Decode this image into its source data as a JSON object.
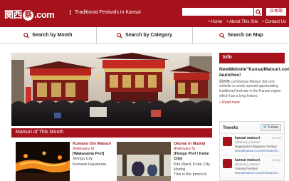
{
  "header": {
    "logo_text_1": "関西",
    "logo_ring": "祭",
    "logo_text_2": ".com",
    "tagline": "Traditional Festivals in Kansai",
    "search_placeholder": "",
    "language_label": "日本語",
    "topnav": [
      "Home",
      "About This Site",
      "Contact Us"
    ]
  },
  "mainnav": [
    {
      "label": "Search by Month"
    },
    {
      "label": "Search by Category"
    },
    {
      "label": "Search on Map"
    }
  ],
  "sidebar": {
    "info_title": "Info",
    "news_title": "NewWebsite\"KansaiMatsuri.com\" launches!",
    "news_body": "関西祭.comKansai Matsuri dot com website is newly opened appreciating traditional festivals in the Kansai region which has a long history.",
    "read_more": "» Read more",
    "tweets_title": "Tweets",
    "follow_label": "Follow",
    "tweets": [
      {
        "name": "kansai matsuri",
        "handle": "@kansai_matsuri",
        "time": "10 Apr",
        "text": "Nagahama Hikiyama Festival",
        "link": "kansaimatsuri.com/en/search/..."
      },
      {
        "name": "kansai matsuri",
        "handle": "@kansai_matsuri",
        "time": "10 Apr",
        "text": "Yasurai Festival",
        "link": "kansaimatsuri.com/en/search/..."
      }
    ]
  },
  "month": {
    "title": "Matsuri of This Month",
    "cards": [
      {
        "name": "Kumano Oto Matsuri",
        "date": "(February 6)",
        "pref": "[Wakayama Pref]",
        "loc1": "Shingu City",
        "loc2": "Kumano Hayatama"
      },
      {
        "name": "Okonai in Mudoji",
        "date": "(February 5)",
        "pref": "[Hyogo Pref / Kobe City]",
        "loc1": "Kita Ward, Kobe City",
        "loc2": "Mudoji",
        "loc3": "This is the protocol"
      }
    ]
  },
  "colors": {
    "brand": "#a5121c"
  }
}
